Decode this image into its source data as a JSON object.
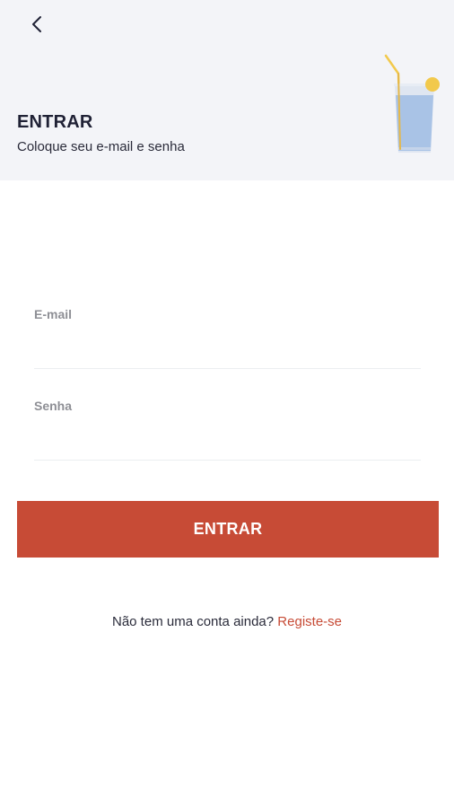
{
  "header": {
    "title": "ENTRAR",
    "subtitle": "Coloque seu e-mail e senha",
    "back_icon": "chevron-left-icon",
    "illustration_icon": "drink-glass-icon"
  },
  "form": {
    "email_label": "E-mail",
    "email_value": "",
    "password_label": "Senha",
    "password_value": "",
    "submit_label": "ENTRAR"
  },
  "register": {
    "prompt": "Não tem uma conta ainda?",
    "link_label": "Registe-se"
  },
  "colors": {
    "accent": "#c74b36",
    "header_bg": "#f3f4f8",
    "title_text": "#1f2135",
    "label_text": "#8e8f95"
  }
}
